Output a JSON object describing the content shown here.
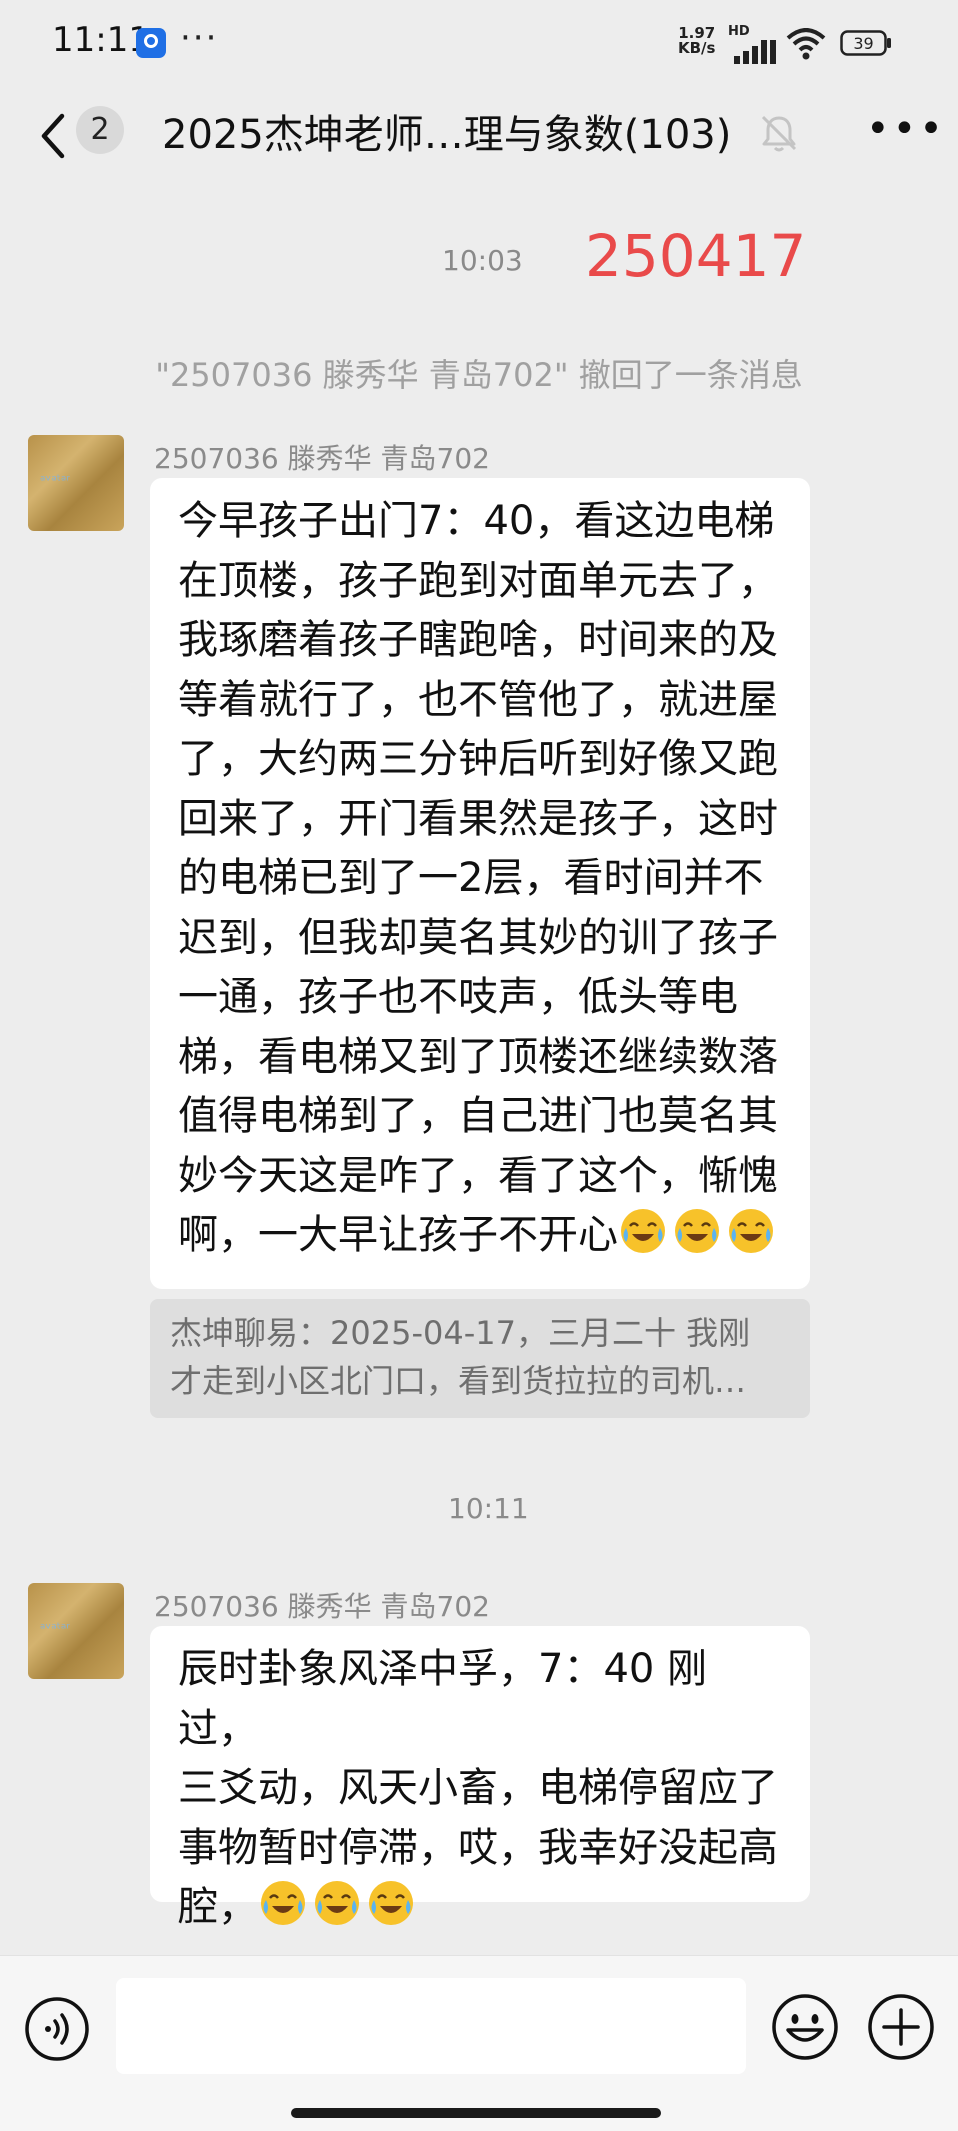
{
  "status_bar": {
    "time": "11:11",
    "overflow": "···",
    "net_speed_value": "1.97",
    "net_speed_unit": "KB/s",
    "hd": "HD",
    "battery": "39",
    "icons": [
      "app-notification-icon",
      "signal-icon",
      "wifi-icon",
      "battery-icon"
    ]
  },
  "header": {
    "unread_count": "2",
    "title": "2025杰坤老师…理与象数(103)",
    "icons": [
      "back-icon",
      "mute-bell-icon",
      "more-icon"
    ]
  },
  "messages": {
    "time1": "10:03",
    "highlight": "250417",
    "system": "\"2507036 滕秀华  青岛702\" 撤回了一条消息",
    "msg1": {
      "sender": "2507036 滕秀华  青岛702",
      "lines": [
        "今早孩子出门7：40，看这边电梯",
        "在顶楼，孩子跑到对面单元去了，",
        "我琢磨着孩子瞎跑啥，时间来的及",
        "等着就行了，也不管他了，就进屋",
        "了，大约两三分钟后听到好像又跑",
        "回来了，开门看果然是孩子，这时",
        "的电梯已到了一2层，看时间并不",
        "迟到，但我却莫名其妙的训了孩子",
        "一通，孩子也不吱声，低头等电",
        "梯，看电梯又到了顶楼还继续数落",
        "值得电梯到了，自己进门也莫名其",
        "妙今天这是咋了，看了这个，惭愧",
        "啊，一大早让孩子不开心"
      ],
      "quote_line1": "杰坤聊易：2025-04-17，三月二十  我刚",
      "quote_line2": "才走到小区北门口，看到货拉拉的司机…"
    },
    "time2": "10:11",
    "msg2": {
      "sender": "2507036 滕秀华  青岛702",
      "lines": [
        "辰时卦象风泽中孚，7：40 刚过，",
        "三爻动，风天小畜，电梯停留应了",
        "事物暂时停滞，哎，我幸好没起高",
        "腔，"
      ]
    },
    "emoji": "laugh-cry-emoji"
  },
  "input_bar": {
    "placeholder": "",
    "icons": [
      "voice-icon",
      "emoji-icon",
      "plus-icon"
    ]
  },
  "colors": {
    "background": "#ededed",
    "highlight": "#e94a4a",
    "bubble": "#ffffff",
    "quote": "#dedede"
  }
}
